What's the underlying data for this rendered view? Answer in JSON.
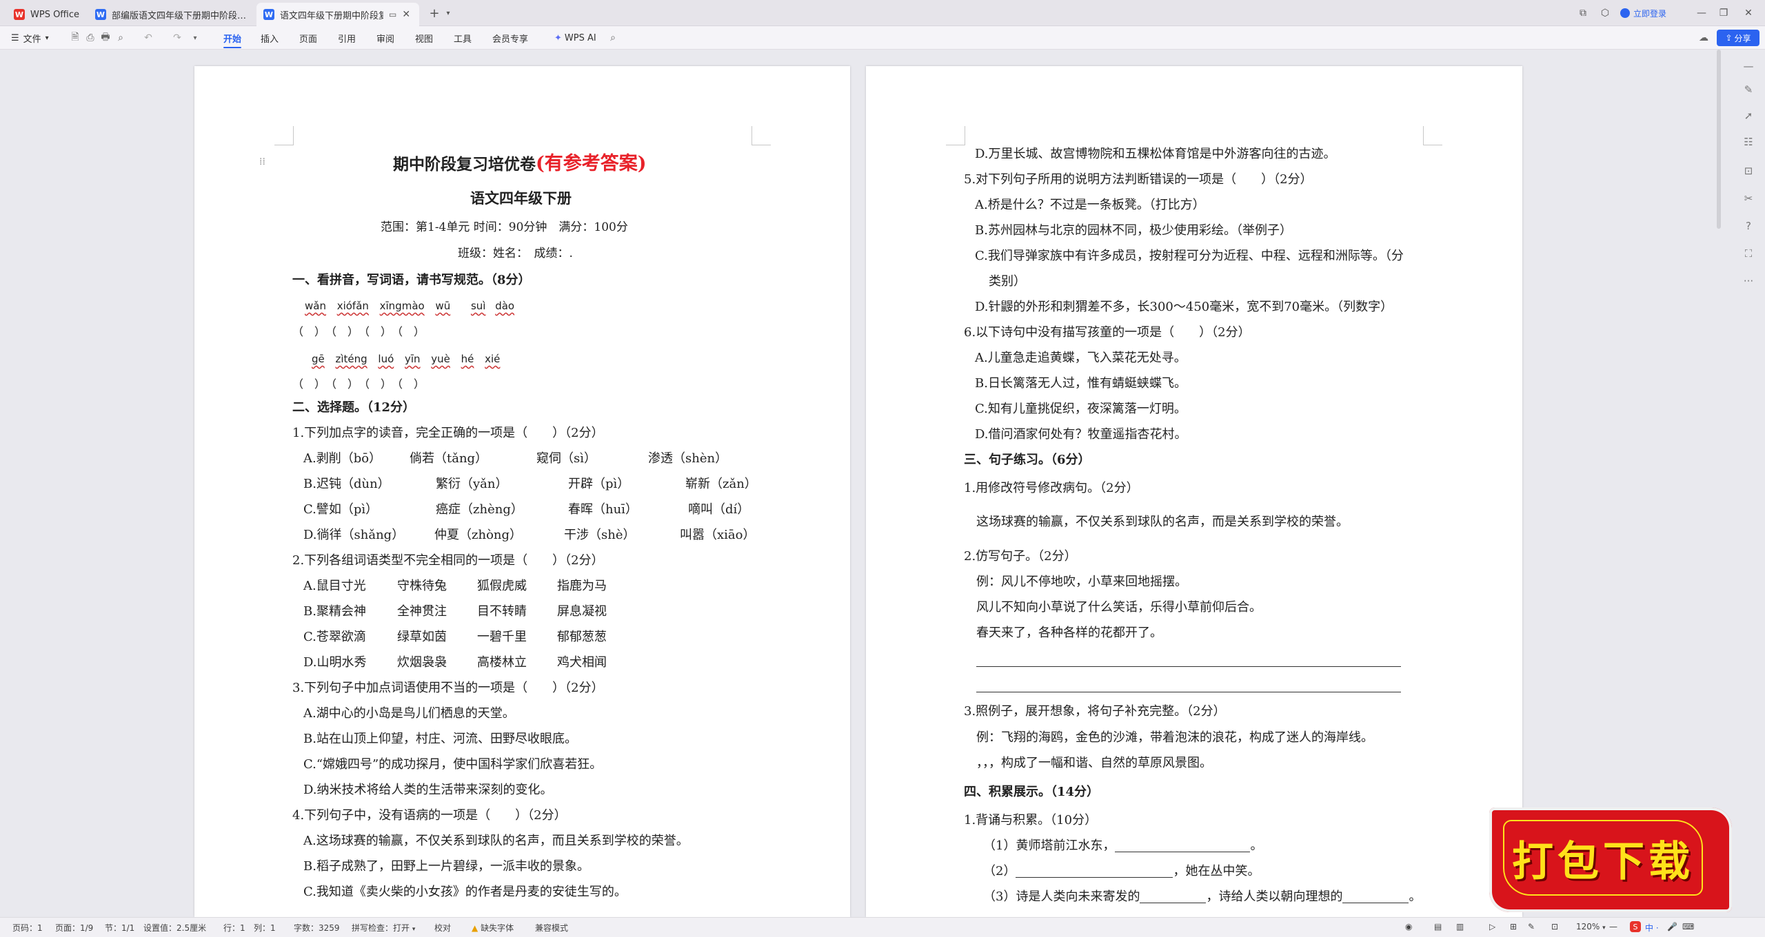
{
  "tabs": {
    "home": "WPS Office",
    "doc1": "部编版语文四年级下册期中阶段复习",
    "doc2": "语文四年级下册期中阶段复习"
  },
  "titlebar": {
    "login": "立即登录"
  },
  "menu": {
    "file": "文件",
    "items": [
      "开始",
      "插入",
      "页面",
      "引用",
      "审阅",
      "视图",
      "工具",
      "会员专享"
    ],
    "wps_ai": "WPS AI",
    "share": "分享"
  },
  "p1": {
    "title_main": "期中阶段复习培优卷",
    "title_red": "(有参考答案)",
    "subtitle": "语文四年级下册",
    "scope": "范围：第1-4单元 时间：90分钟　满分：100分",
    "class": "班级：姓名：　成绩：.",
    "s1": "一、看拼音，写词语，请书写规范。（8分）",
    "py1": [
      "wǎn",
      "xiófǎn",
      "xīngmào",
      "wū",
      "suì",
      "dào"
    ],
    "br1": "（　）　（　）　（　）　（　）",
    "py2": [
      "gē",
      "zìténg",
      "luó",
      "yīn",
      "yuè",
      "hé",
      "xié"
    ],
    "br2": "（　）　（　）　（　）　（　）",
    "s2": "二、选择题。（12分）",
    "q1": "1.下列加点字的读音，完全正确的一项是（　　）（2分）",
    "q1a": [
      "A.剥削（bō）",
      "倘若（tǎng）",
      "窥伺（sì）",
      "渗透（shèn）"
    ],
    "q1b": [
      "B.迟钝（dùn）",
      "繁衍（yǎn）",
      "开辟（pì）",
      "崭新（zǎn）"
    ],
    "q1c": [
      "C.譬如（pì）",
      "癌症（zhèng）",
      "春晖（huī）",
      "嘀叫（dí）"
    ],
    "q1d": [
      "D.徜徉（shǎng）",
      "仲夏（zhòng）",
      "干涉（shè）",
      "叫嚣（xiāo）"
    ],
    "q2": "2.下列各组词语类型不完全相同的一项是（　　）（2分）",
    "q2a": [
      "A.鼠目寸光",
      "守株待兔",
      "狐假虎威",
      "指鹿为马"
    ],
    "q2b": [
      "B.聚精会神",
      "全神贯注",
      "目不转睛",
      "屏息凝视"
    ],
    "q2c": [
      "C.苍翠欲滴",
      "绿草如茵",
      "一碧千里",
      "郁郁葱葱"
    ],
    "q2d": [
      "D.山明水秀",
      "炊烟袅袅",
      "高楼林立",
      "鸡犬相闻"
    ],
    "q3": "3.下列句子中加点词语使用不当的一项是（　　）（2分）",
    "q3a": "A.湖中心的小岛是鸟儿们栖息的天堂。",
    "q3b": "B.站在山顶上仰望，村庄、河流、田野尽收眼底。",
    "q3c": "C.“嫦娥四号”的成功探月，使中国科学家们欣喜若狂。",
    "q3d": "D.纳米技术将给人类的生活带来深刻的变化。",
    "q4": "4.下列句子中，没有语病的一项是（　　）（2分）",
    "q4a": "A.这场球赛的输赢，不仅关系到球队的名声，而且关系到学校的荣誉。",
    "q4b": "B.稻子成熟了，田野上一片碧绿，一派丰收的景象。",
    "q4c": "C.我知道《卖火柴的小女孩》的作者是丹麦的安徒生写的。"
  },
  "p2": {
    "q4d": "D.万里长城、故宫博物院和五棵松体育馆是中外游客向往的古迹。",
    "q5": "5.对下列句子所用的说明方法判断错误的一项是（　　）（2分）",
    "q5a": "A.桥是什么？不过是一条板凳。（打比方）",
    "q5b": "B.苏州园林与北京的园林不同，极少使用彩绘。（举例子）",
    "q5c1": "C.我们导弹家族中有许多成员，按射程可分为近程、中程、远程和洲际等。（分",
    "q5c2": "类别）",
    "q5d": "D.针鼹的外形和刺猬差不多，长300～450毫米，宽不到70毫米。（列数字）",
    "q6": "6.以下诗句中没有描写孩童的一项是（　　）（2分）",
    "q6a": "A.儿童急走追黄蝶，飞入菜花无处寻。",
    "q6b": "B.日长篱落无人过，惟有蜻蜓蛱蝶飞。",
    "q6c": "C.知有儿童挑促织，夜深篱落一灯明。",
    "q6d": "D.借问酒家何处有？牧童遥指杏花村。",
    "s3": "三、句子练习。（6分）",
    "t1": "1.用修改符号修改病句。（2分）",
    "t1s": "这场球赛的输赢，不仅关系到球队的名声，而是关系到学校的荣誉。",
    "t2": "2.仿写句子。（2分）",
    "t2ex": "例：风儿不停地吹，小草来回地摇摆。",
    "t2a": "风儿不知向小草说了什么笑话，乐得小草前仰后合。",
    "t2b": "春天来了，各种各样的花都开了。",
    "t3": "3.照例子，展开想象，将句子补充完整。（2分）",
    "t3ex": "例：飞翔的海鸥，金色的沙滩，带着泡沫的浪花，构成了迷人的海岸线。",
    "t3a": "，，，构成了一幅和谐、自然的草原风景图。",
    "s4": "四、积累展示。（14分）",
    "k1": "1.背诵与积累。（10分）",
    "k1a_pre": "（1）黄师塔前江水东，",
    "k1a_post": "。",
    "k1b_pre": "（2）",
    "k1b_post": "，她在丛中笑。",
    "k1c_pre": "（3）诗是人类向未来寄发的",
    "k1c_mid": "，诗给人类以朝向理想的",
    "k1c_post": "。"
  },
  "badge": "打包下载",
  "status": {
    "page": "页码：1",
    "pages": "页面：1/9",
    "section": "节：1/1",
    "setting": "设置值：2.5厘米",
    "row": "行：1",
    "col": "列：1",
    "words": "字数：3259",
    "spell": "拼写检查：打开",
    "proof": "校对",
    "missing_font": "缺失字体",
    "compat": "兼容模式",
    "zoom": "120%"
  },
  "icons": [
    "wps-logo-icon",
    "doc-icon",
    "plus-icon",
    "chevron-down-icon",
    "search-icon",
    "avatar-icon",
    "minimize-icon",
    "restore-icon",
    "close-icon",
    "undo-icon",
    "redo-icon",
    "save-icon",
    "print-icon",
    "share-icon",
    "warning-icon",
    "eye-icon"
  ],
  "colors": {
    "accent": "#2b63f0",
    "title_red": "#e8222a",
    "wps_red": "#e8322b",
    "badge_bg": "#d8141b",
    "badge_text": "#ffe21a"
  }
}
